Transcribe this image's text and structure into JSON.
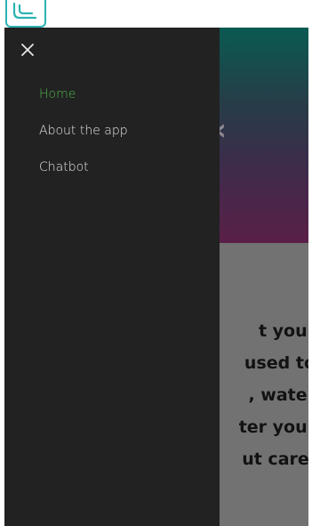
{
  "app": {
    "logo_icon": "app-logo-icon",
    "accent_color": "#2bb3b1"
  },
  "drawer": {
    "close_icon": "close-icon",
    "items": [
      {
        "label": "Home",
        "active": true
      },
      {
        "label": "About the app",
        "active": false
      },
      {
        "label": "Chatbot",
        "active": false
      }
    ],
    "background": "#222222",
    "active_color": "#4cb44c",
    "text_color": "#e6e6e6"
  },
  "content": {
    "carousel_arrow_icon": "chevron-left-icon",
    "lines": [
      "t your",
      "used to",
      ", water",
      "ter your",
      "ut care,"
    ]
  }
}
